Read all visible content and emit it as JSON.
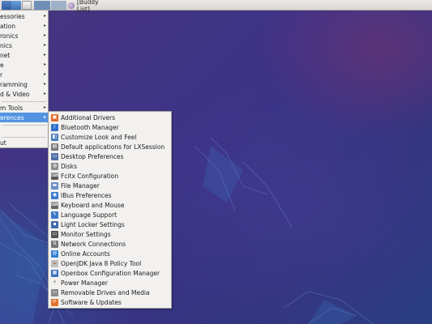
{
  "panel": {
    "task_label": "[Buddy List]"
  },
  "main_menu": {
    "items": [
      {
        "label": "essories",
        "arrow": "▸"
      },
      {
        "label": "ation",
        "arrow": "▸"
      },
      {
        "label": "ronics",
        "arrow": "▸"
      },
      {
        "label": "nics",
        "arrow": "▸"
      },
      {
        "label": "net",
        "arrow": "▸"
      },
      {
        "label": "e",
        "arrow": "▸"
      },
      {
        "label": "r",
        "arrow": "▸"
      },
      {
        "label": "ramming",
        "arrow": "▸"
      },
      {
        "label": "d & Video",
        "arrow": "▸"
      },
      {
        "label": "m Tools",
        "arrow": "▸"
      },
      {
        "label": "erences",
        "arrow": "▸"
      },
      {
        "label": "",
        "arrow": ""
      },
      {
        "label": "ut",
        "arrow": ""
      }
    ]
  },
  "submenu": {
    "items": [
      {
        "label": "Additional Drivers",
        "icon": "drivers-icon",
        "color": "#e06a2c",
        "glyph": "▣"
      },
      {
        "label": "Bluetooth Manager",
        "icon": "bluetooth-icon",
        "color": "#2f6fc9",
        "glyph": "ᛒ"
      },
      {
        "label": "Customize Look and Feel",
        "icon": "appearance-icon",
        "color": "#4a7fc2",
        "glyph": "◧"
      },
      {
        "label": "Default applications for LXSession",
        "icon": "default-apps-icon",
        "color": "#7a7a7a",
        "glyph": "▤"
      },
      {
        "label": "Desktop Preferences",
        "icon": "desktop-icon",
        "color": "#4f6fa8",
        "glyph": "▭"
      },
      {
        "label": "Disks",
        "icon": "disks-icon",
        "color": "#8c8c8c",
        "glyph": "◍"
      },
      {
        "label": "Fcitx Configuration",
        "icon": "keyboard-config-icon",
        "color": "#5a5a5a",
        "glyph": "⌨"
      },
      {
        "label": "File Manager",
        "icon": "folder-icon",
        "color": "#6a8fc3",
        "glyph": "▬"
      },
      {
        "label": "IBus Preferences",
        "icon": "ibus-icon",
        "color": "#3c7bd0",
        "glyph": "◉"
      },
      {
        "label": "Keyboard and Mouse",
        "icon": "keyboard-mouse-icon",
        "color": "#666666",
        "glyph": "⌨"
      },
      {
        "label": "Language Support",
        "icon": "language-icon",
        "color": "#3a78c8",
        "glyph": "✎"
      },
      {
        "label": "Light Locker Settings",
        "icon": "lock-icon",
        "color": "#3e6ba8",
        "glyph": "▪"
      },
      {
        "label": "Monitor Settings",
        "icon": "monitor-icon",
        "color": "#555555",
        "glyph": "▭"
      },
      {
        "label": "Network Connections",
        "icon": "network-icon",
        "color": "#777777",
        "glyph": "⇅"
      },
      {
        "label": "Online Accounts",
        "icon": "accounts-icon",
        "color": "#2f7fd6",
        "glyph": "@"
      },
      {
        "label": "OpenJDK Java 8 Policy Tool",
        "icon": "java-icon",
        "color": "#c0c0c0",
        "glyph": "☕"
      },
      {
        "label": "Openbox Configuration Manager",
        "icon": "openbox-icon",
        "color": "#3a6fc0",
        "glyph": "▦"
      },
      {
        "label": "Power Manager",
        "icon": "power-icon",
        "color": "#f2f1f0",
        "glyph": "⚡"
      },
      {
        "label": "Removable Drives and Media",
        "icon": "drive-icon",
        "color": "#8a8a8a",
        "glyph": "▭"
      },
      {
        "label": "Software & Updates",
        "icon": "software-icon",
        "color": "#e0702a",
        "glyph": "⟳"
      }
    ]
  }
}
